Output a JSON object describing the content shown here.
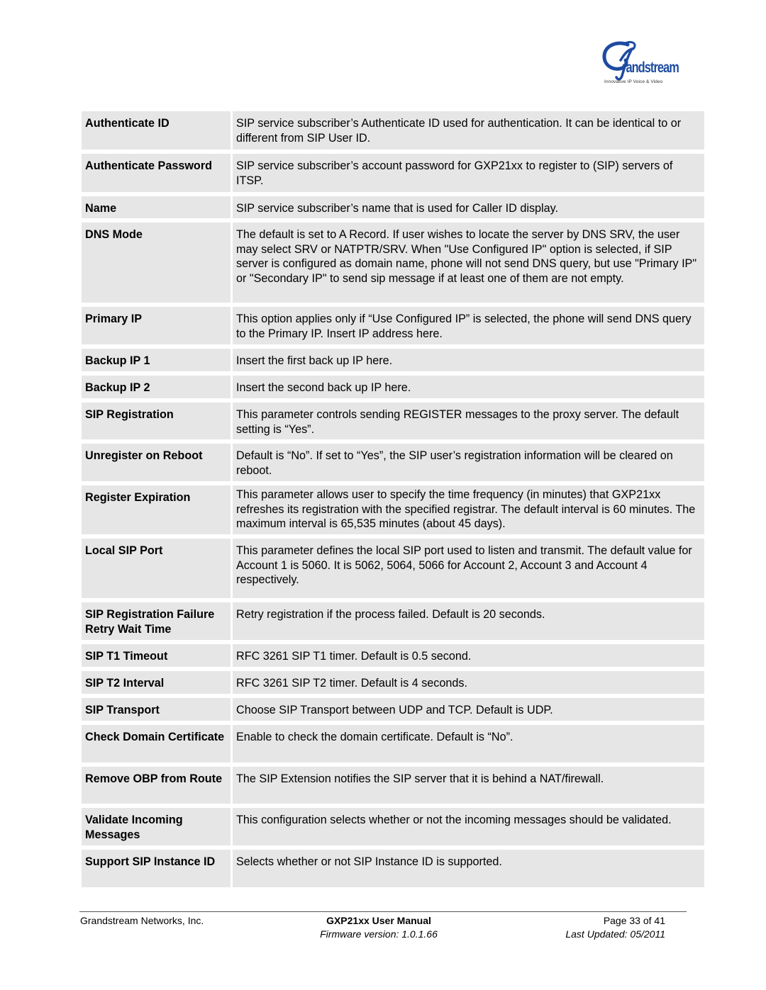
{
  "header": {
    "logo": {
      "brand": "randstream",
      "initial": "G",
      "tagline": "Innovative IP Voice & Video",
      "color": "#1e4ba0"
    }
  },
  "table": {
    "rows": [
      {
        "label": "Authenticate ID",
        "value": "SIP service subscriber’s Authenticate ID used for authentication. It can be identical to or different from SIP User ID."
      },
      {
        "label": "Authenticate Password",
        "value": "SIP service subscriber’s account password for GXP21xx to register to (SIP) servers of ITSP."
      },
      {
        "label": "Name",
        "value": "SIP service subscriber’s name that is used for Caller ID display."
      },
      {
        "label": "DNS Mode",
        "value": "The default is set to A Record. If user wishes to locate the server by DNS SRV, the user may select SRV or NATPTR/SRV. When \"Use Configured IP\" option is selected, if SIP server is configured as domain name, phone will not send DNS query, but use \"Primary IP\" or \"Secondary IP\" to send sip message if at least one of them are not empty."
      },
      {
        "label": "Primary IP",
        "value": "This option applies only if “Use Configured IP” is selected, the phone will send DNS query to the Primary IP. Insert IP address here."
      },
      {
        "label": "Backup IP 1",
        "value": "Insert the first back up IP here."
      },
      {
        "label": "Backup IP 2",
        "value": "Insert the second back up IP here."
      },
      {
        "label": "SIP Registration",
        "value": "This parameter controls sending REGISTER messages to the proxy server. The default setting is “Yes”."
      },
      {
        "label": "Unregister on Reboot",
        "value": "Default is “No”. If set to “Yes”, the SIP user’s registration information will be cleared on reboot."
      },
      {
        "label": "Register Expiration",
        "value": "This parameter allows user to specify the time frequency (in minutes) that GXP21xx refreshes its registration with the specified registrar. The default interval is 60 minutes. The maximum interval is 65,535 minutes (about 45 days)."
      },
      {
        "label": "Local SIP Port",
        "value": "This parameter defines the local SIP port used to listen and transmit. The default value for Account 1 is 5060. It is 5062, 5064, 5066 for Account 2, Account 3 and Account 4 respectively."
      },
      {
        "label": "SIP Registration Failure Retry Wait Time",
        "value": "Retry registration if the process failed. Default is 20 seconds."
      },
      {
        "label": "SIP T1 Timeout",
        "value": "RFC 3261 SIP T1 timer. Default is 0.5 second."
      },
      {
        "label": "SIP T2 Interval",
        "value": "RFC 3261 SIP T2 timer. Default is 4 seconds."
      },
      {
        "label": "SIP Transport",
        "value": "Choose SIP Transport between UDP and TCP. Default is UDP."
      },
      {
        "label": "Check Domain Certificate",
        "value": "Enable to check the domain certificate. Default is “No”."
      },
      {
        "label": "Remove OBP from Route",
        "value": "The SIP Extension notifies the SIP server that it is behind a NAT/firewall."
      },
      {
        "label": "Validate Incoming Messages",
        "value": "This configuration selects whether or not the incoming messages should be validated."
      },
      {
        "label": "Support SIP Instance ID",
        "value": "Selects whether or not SIP Instance ID is supported."
      }
    ]
  },
  "footer": {
    "company": "Grandstream Networks, Inc.",
    "manual_title": "GXP21xx User Manual",
    "firmware": "Firmware version: 1.0.1.66",
    "page": "Page 33 of 41",
    "last_updated": "Last Updated:  05/2011"
  }
}
